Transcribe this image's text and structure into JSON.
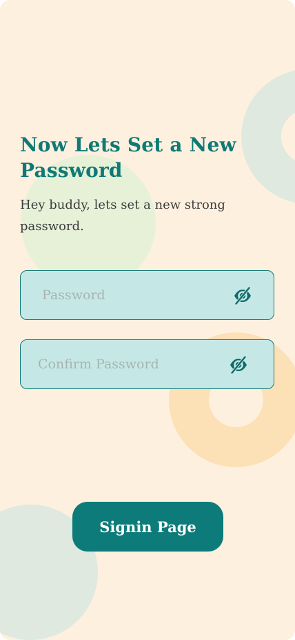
{
  "page": {
    "title": "Now Lets Set a New Password",
    "subtitle": "Hey buddy, lets set a new strong password."
  },
  "form": {
    "password": {
      "placeholder": "Password",
      "value": "",
      "toggle_icon": "eye-slash-icon"
    },
    "confirm_password": {
      "placeholder": "Confirm Password",
      "value": "",
      "toggle_icon": "eye-slash-icon"
    }
  },
  "actions": {
    "signin_label": "Signin Page"
  },
  "colors": {
    "background": "#fef0df",
    "primary": "#0d7b7a",
    "field_fill": "#c5e8e6",
    "decor_green": "#dfe9df",
    "decor_lime": "#e6f1d8",
    "decor_orange": "#fce0b6",
    "subtitle_text": "#3d3d3d"
  }
}
